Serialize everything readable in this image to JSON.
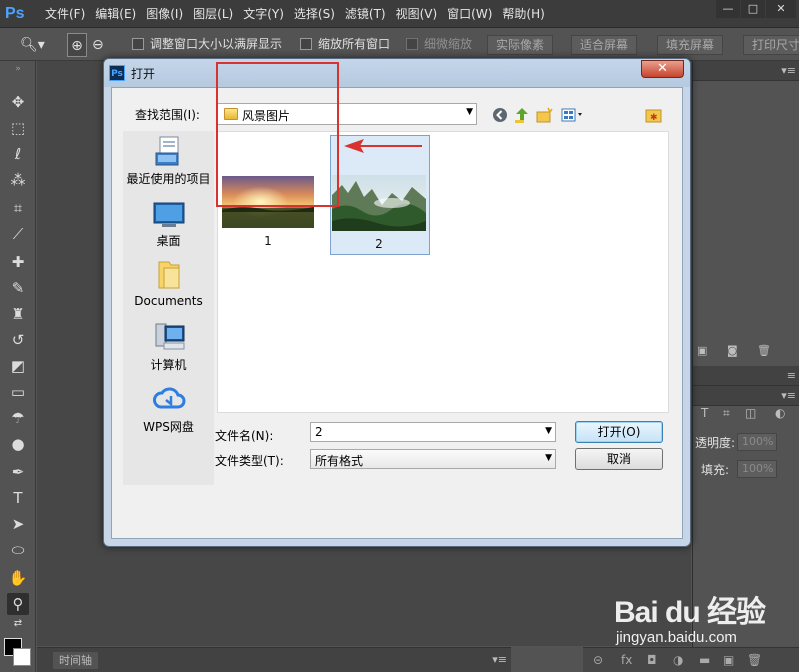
{
  "app": {
    "logo": "Ps",
    "menu": [
      "文件(F)",
      "编辑(E)",
      "图像(I)",
      "图层(L)",
      "文字(Y)",
      "选择(S)",
      "滤镜(T)",
      "视图(V)",
      "窗口(W)",
      "帮助(H)"
    ],
    "window_buttons": {
      "minimize": "—",
      "maximize": "□",
      "close": "✕"
    }
  },
  "options_bar": {
    "resize_windows_label": "调整窗口大小以满屏显示",
    "zoom_all_label": "缩放所有窗口",
    "scrubby_zoom_label": "细微缩放",
    "actual_pixels": "实际像素",
    "fit_screen": "适合屏幕",
    "fill_screen": "填充屏幕",
    "print_size": "打印尺寸"
  },
  "tools": [
    "move-icon",
    "marquee-icon",
    "lasso-icon",
    "magic-wand-icon",
    "crop-icon",
    "eyedropper-icon",
    "healing-brush-icon",
    "brush-icon",
    "clone-stamp-icon",
    "history-brush-icon",
    "eraser-icon",
    "gradient-icon",
    "blur-icon",
    "dodge-icon",
    "pen-icon",
    "type-icon",
    "path-selection-icon",
    "ellipse-icon",
    "hand-icon",
    "zoom-icon"
  ],
  "right_panel": {
    "opacity_label": "透明度:",
    "opacity_value": "100%",
    "fill_label": "填充:",
    "fill_value": "100%"
  },
  "timeline": {
    "tab": "时间轴"
  },
  "watermark": {
    "title": "Bai du 经验",
    "url": "jingyan.baidu.com"
  },
  "dialog": {
    "title": "打开",
    "close": "✕",
    "look_in_label": "查找范围(I):",
    "look_in_value": "风景图片",
    "places": [
      {
        "label": "最近使用的项目",
        "icon": "recent-items-icon"
      },
      {
        "label": "桌面",
        "icon": "desktop-icon"
      },
      {
        "label": "Documents",
        "icon": "documents-folder-icon"
      },
      {
        "label": "计算机",
        "icon": "computer-icon"
      },
      {
        "label": "WPS网盘",
        "icon": "wps-cloud-icon"
      }
    ],
    "files": [
      {
        "name": "1",
        "selected": false
      },
      {
        "name": "2",
        "selected": true
      }
    ],
    "filename_label": "文件名(N):",
    "filename_value": "2",
    "filetype_label": "文件类型(T):",
    "filetype_value": "所有格式",
    "open_button": "打开(O)",
    "cancel_button": "取消"
  },
  "colors": {
    "highlight_red": "#d9332f",
    "ps_blue": "#4aa3ff",
    "selection_fill": "#dce9f7"
  }
}
